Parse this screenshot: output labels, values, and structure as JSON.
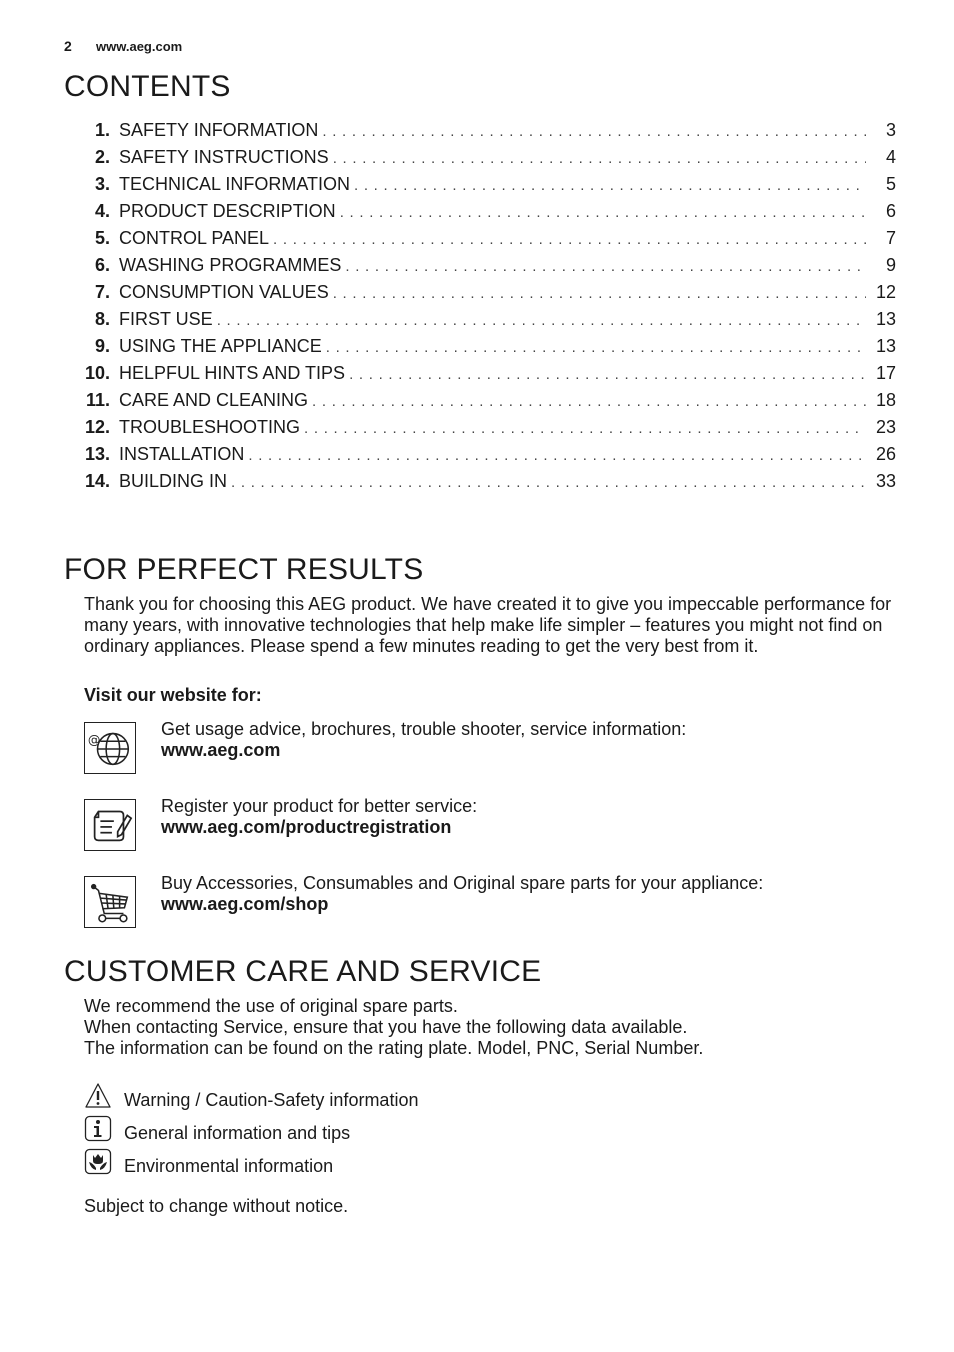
{
  "header": {
    "page_number": "2",
    "website": "www.aeg.com"
  },
  "contents": {
    "title": "CONTENTS",
    "items": [
      {
        "num": "1.",
        "title": "SAFETY INFORMATION",
        "page": "3"
      },
      {
        "num": "2.",
        "title": "SAFETY INSTRUCTIONS",
        "page": "4"
      },
      {
        "num": "3.",
        "title": "TECHNICAL INFORMATION",
        "page": "5"
      },
      {
        "num": "4.",
        "title": "PRODUCT DESCRIPTION",
        "page": "6"
      },
      {
        "num": "5.",
        "title": "CONTROL PANEL",
        "page": "7"
      },
      {
        "num": "6.",
        "title": "WASHING PROGRAMMES",
        "page": "9"
      },
      {
        "num": "7.",
        "title": "CONSUMPTION VALUES",
        "page": "12"
      },
      {
        "num": "8.",
        "title": "FIRST USE",
        "page": "13"
      },
      {
        "num": "9.",
        "title": "USING THE APPLIANCE",
        "page": "13"
      },
      {
        "num": "10.",
        "title": "HELPFUL HINTS AND TIPS",
        "page": "17"
      },
      {
        "num": "11.",
        "title": "CARE AND CLEANING",
        "page": "18"
      },
      {
        "num": "12.",
        "title": "TROUBLESHOOTING",
        "page": "23"
      },
      {
        "num": "13.",
        "title": "INSTALLATION",
        "page": "26"
      },
      {
        "num": "14.",
        "title": "BUILDING IN",
        "page": "33"
      }
    ]
  },
  "perfect_results": {
    "title": "FOR PERFECT RESULTS",
    "intro": "Thank you for choosing this AEG product. We have created it to give you impeccable performance for many years, with innovative technologies that help make life simpler – features you might not find on ordinary appliances. Please spend a few minutes reading to get the very best from it.",
    "visit_label": "Visit our website for:",
    "links": [
      {
        "icon": "globe-at-icon",
        "text": "Get usage advice, brochures, trouble shooter, service information:",
        "url": "www.aeg.com"
      },
      {
        "icon": "document-pen-icon",
        "text": "Register your product for better service:",
        "url": "www.aeg.com/productregistration"
      },
      {
        "icon": "shopping-cart-icon",
        "text": "Buy Accessories, Consumables and Original spare parts for your appliance:",
        "url": "www.aeg.com/shop"
      }
    ]
  },
  "customer_care": {
    "title": "CUSTOMER CARE AND SERVICE",
    "lines": [
      "We recommend the use of original spare parts.",
      "When contacting Service, ensure that you have the following data available.",
      "The information can be found on the rating plate. Model, PNC, Serial Number."
    ],
    "legend": [
      {
        "icon": "warning-triangle-icon",
        "text": "Warning / Caution-Safety information"
      },
      {
        "icon": "info-icon",
        "text": "General information and tips"
      },
      {
        "icon": "environment-flower-icon",
        "text": "Environmental information"
      }
    ],
    "notice": "Subject to change without notice."
  }
}
